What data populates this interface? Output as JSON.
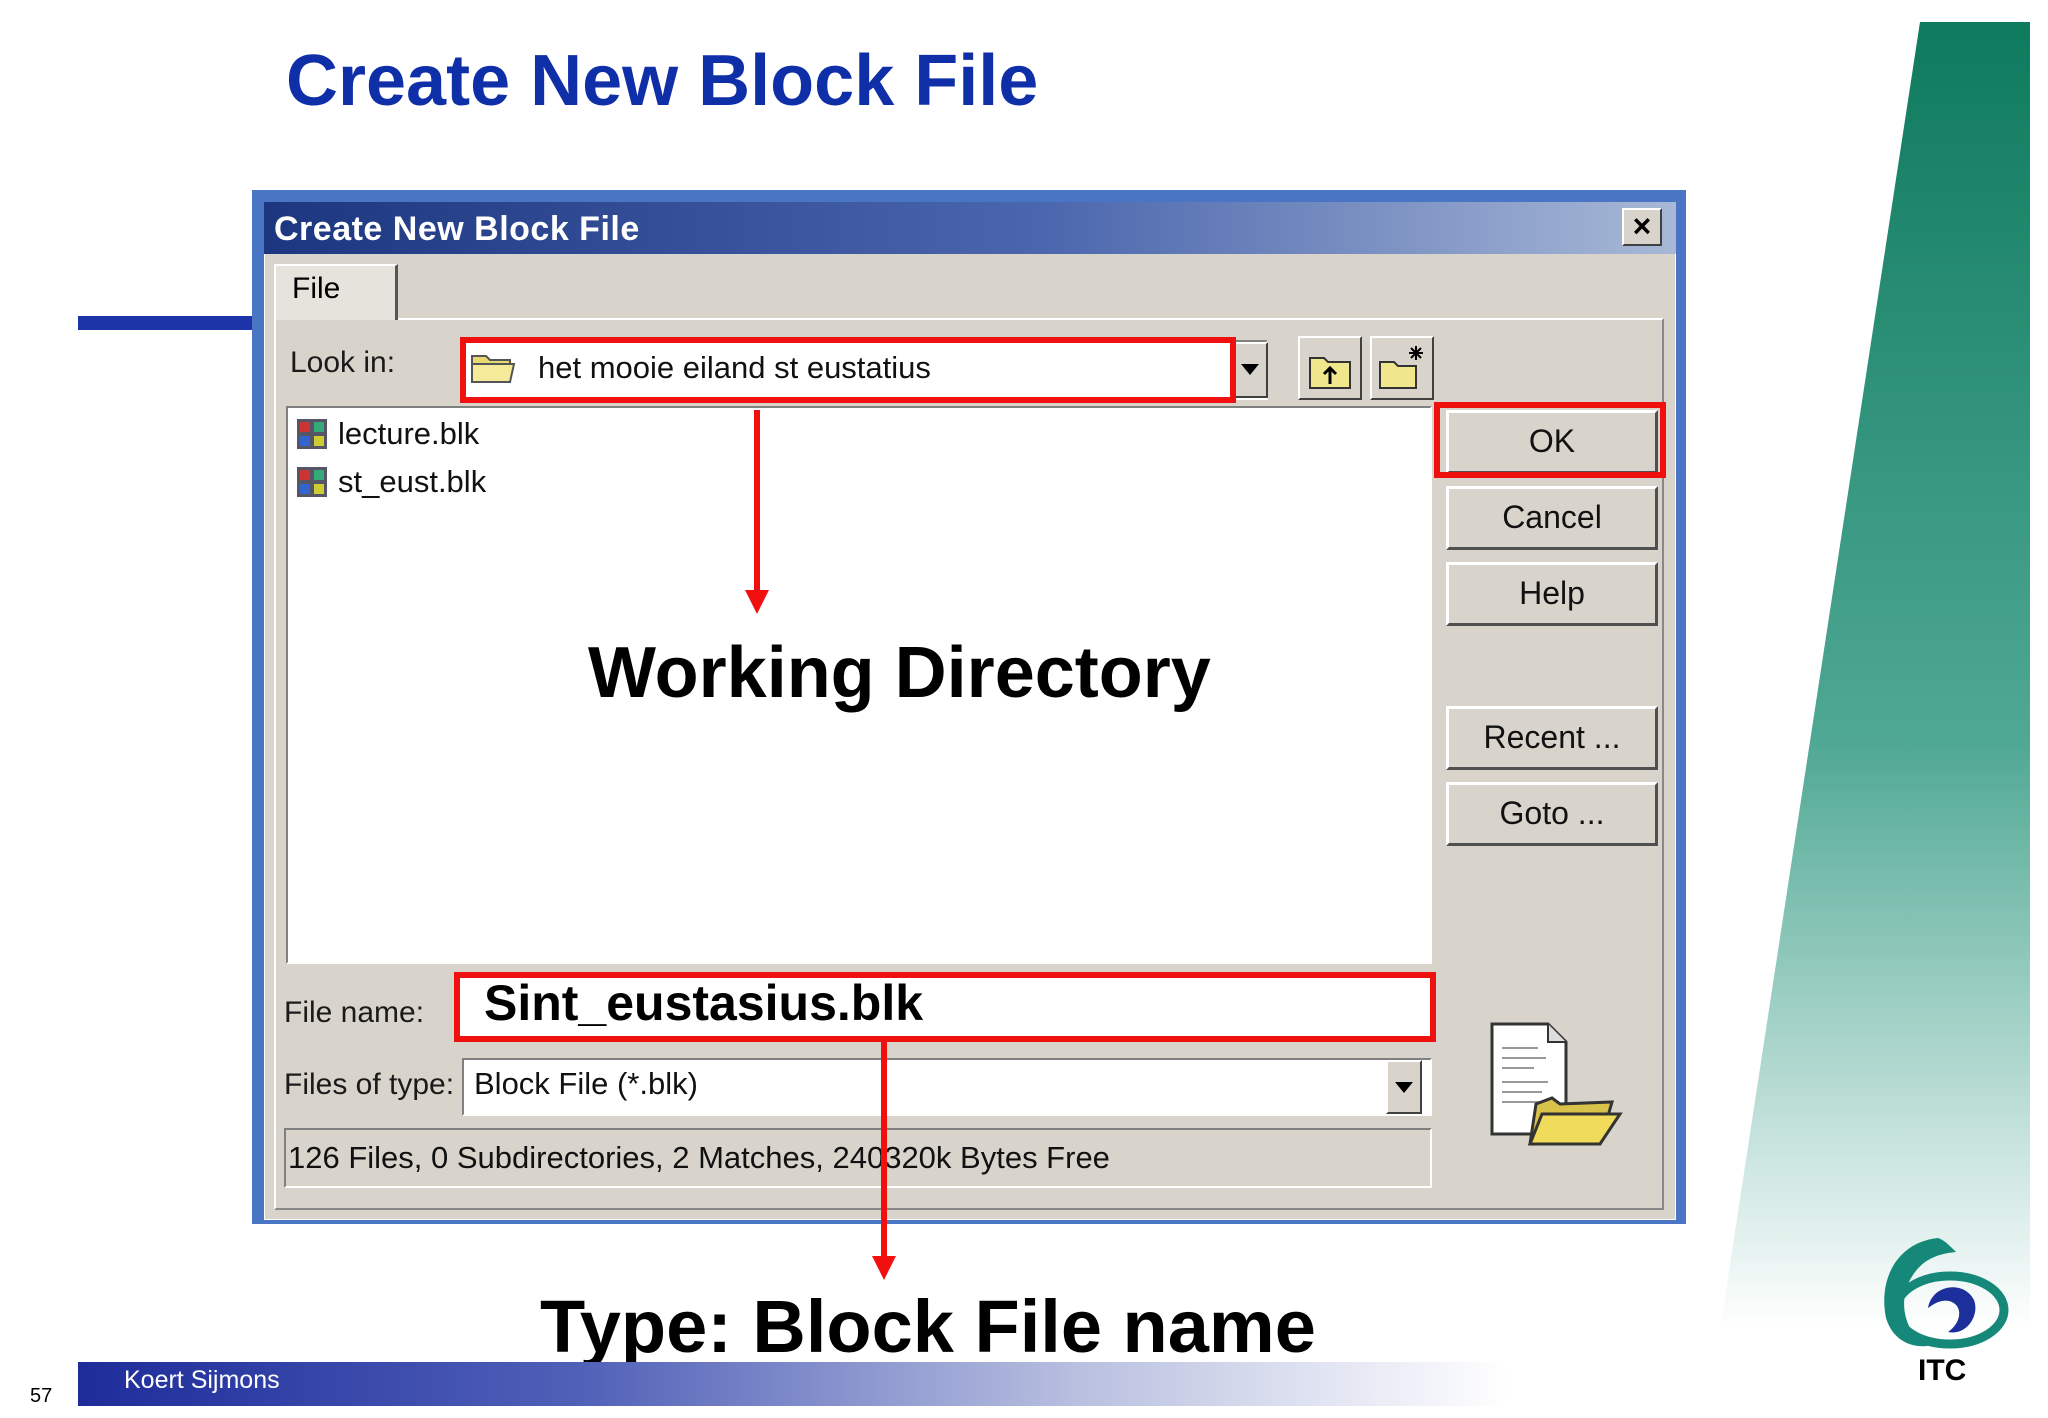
{
  "slide": {
    "title": "Create New Block File",
    "author": "Koert Sijmons",
    "page_number": "57",
    "logo_text": "ITC"
  },
  "dialog": {
    "title": "Create New Block File",
    "close_label": "×",
    "tab_label": "File",
    "look_in_label": "Look in:",
    "look_in_value": "het mooie eiland st eustatius",
    "files": [
      {
        "name": "lecture.blk"
      },
      {
        "name": "st_eust.blk"
      }
    ],
    "buttons": {
      "ok": "OK",
      "cancel": "Cancel",
      "help": "Help",
      "recent": "Recent ...",
      "goto": "Goto ..."
    },
    "file_name_label": "File name:",
    "file_name_value": "Sint_eustasius.blk",
    "file_type_label": "Files of type:",
    "file_type_value": "Block File (*.blk)",
    "status": "126 Files, 0 Subdirectories, 2 Matches, 240320k Bytes Free"
  },
  "annotations": {
    "working_directory": "Working Directory",
    "type_filename": "Type: Block File name"
  },
  "colors": {
    "title_blue": "#0f2fa8",
    "highlight_red": "#f01010",
    "teal": "#1d8a6c"
  }
}
